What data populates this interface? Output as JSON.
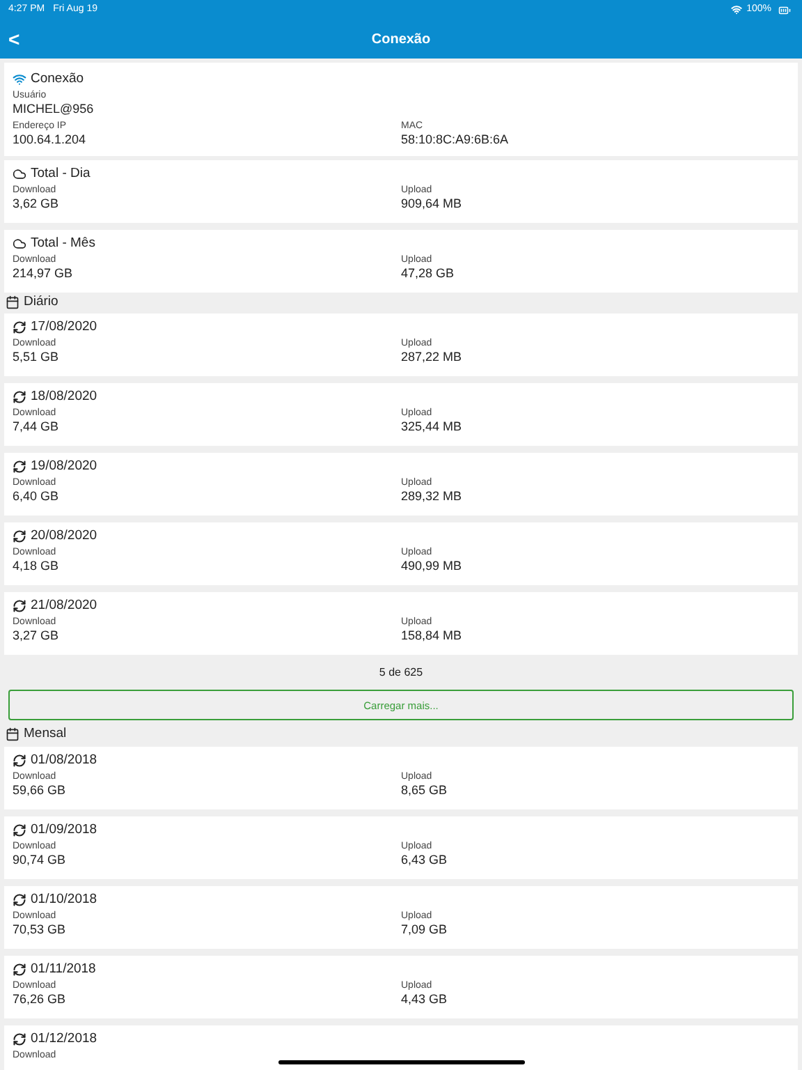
{
  "status_bar": {
    "time": "4:27 PM",
    "date": "Fri Aug 19",
    "battery": "100%"
  },
  "nav": {
    "back": "<",
    "title": "Conexão"
  },
  "connection": {
    "title": "Conexão",
    "user_label": "Usuário",
    "user": "MICHEL@956",
    "ip_label": "Endereço IP",
    "ip": "100.64.1.204",
    "mac_label": "MAC",
    "mac": "58:10:8C:A9:6B:6A"
  },
  "totals": [
    {
      "title": "Total - Dia",
      "download_label": "Download",
      "download": "3,62 GB",
      "upload_label": "Upload",
      "upload": "909,64 MB"
    },
    {
      "title": "Total - Mês",
      "download_label": "Download",
      "download": "214,97 GB",
      "upload_label": "Upload",
      "upload": "47,28 GB"
    }
  ],
  "daily": {
    "title": "Diário",
    "rows": [
      {
        "date": "17/08/2020",
        "download_label": "Download",
        "download": "5,51 GB",
        "upload_label": "Upload",
        "upload": "287,22 MB"
      },
      {
        "date": "18/08/2020",
        "download_label": "Download",
        "download": "7,44 GB",
        "upload_label": "Upload",
        "upload": "325,44 MB"
      },
      {
        "date": "19/08/2020",
        "download_label": "Download",
        "download": "6,40 GB",
        "upload_label": "Upload",
        "upload": "289,32 MB"
      },
      {
        "date": "20/08/2020",
        "download_label": "Download",
        "download": "4,18 GB",
        "upload_label": "Upload",
        "upload": "490,99 MB"
      },
      {
        "date": "21/08/2020",
        "download_label": "Download",
        "download": "3,27 GB",
        "upload_label": "Upload",
        "upload": "158,84 MB"
      }
    ],
    "count": "5 de 625",
    "load_more": "Carregar mais..."
  },
  "monthly": {
    "title": "Mensal",
    "rows": [
      {
        "date": "01/08/2018",
        "download_label": "Download",
        "download": "59,66 GB",
        "upload_label": "Upload",
        "upload": "8,65 GB"
      },
      {
        "date": "01/09/2018",
        "download_label": "Download",
        "download": "90,74 GB",
        "upload_label": "Upload",
        "upload": "6,43 GB"
      },
      {
        "date": "01/10/2018",
        "download_label": "Download",
        "download": "70,53 GB",
        "upload_label": "Upload",
        "upload": "7,09 GB"
      },
      {
        "date": "01/11/2018",
        "download_label": "Download",
        "download": "76,26 GB",
        "upload_label": "Upload",
        "upload": "4,43 GB"
      },
      {
        "date": "01/12/2018",
        "download_label": "Download"
      }
    ]
  }
}
